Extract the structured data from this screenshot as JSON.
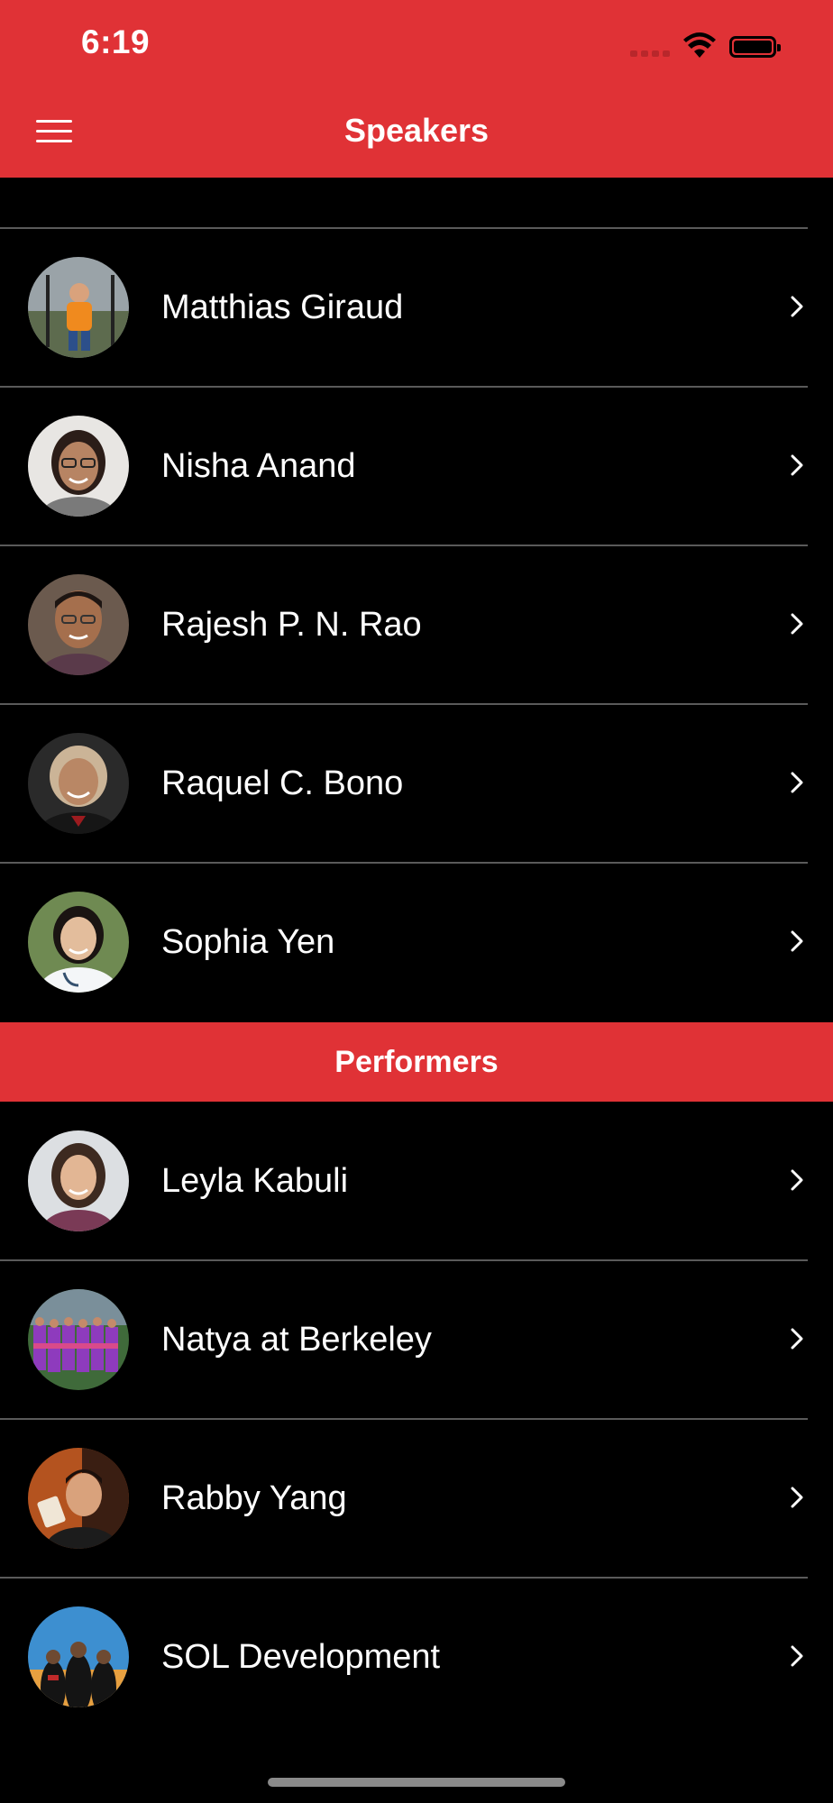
{
  "status_bar": {
    "time": "6:19"
  },
  "nav": {
    "title": "Speakers"
  },
  "speakers": [
    {
      "name": "Matthias Giraud"
    },
    {
      "name": "Nisha Anand"
    },
    {
      "name": "Rajesh P. N. Rao"
    },
    {
      "name": "Raquel C. Bono"
    },
    {
      "name": "Sophia Yen"
    }
  ],
  "performers_section": {
    "title": "Performers"
  },
  "performers": [
    {
      "name": "Leyla Kabuli"
    },
    {
      "name": "Natya at Berkeley"
    },
    {
      "name": "Rabby Yang"
    },
    {
      "name": "SOL Development"
    }
  ],
  "colors": {
    "accent": "#E03236",
    "background": "#000000",
    "divider": "#5a5a5a"
  },
  "icons": {
    "menu": "hamburger-menu-icon",
    "row_disclosure": "chevron-right-icon",
    "wifi": "wifi-icon",
    "battery": "battery-icon"
  }
}
